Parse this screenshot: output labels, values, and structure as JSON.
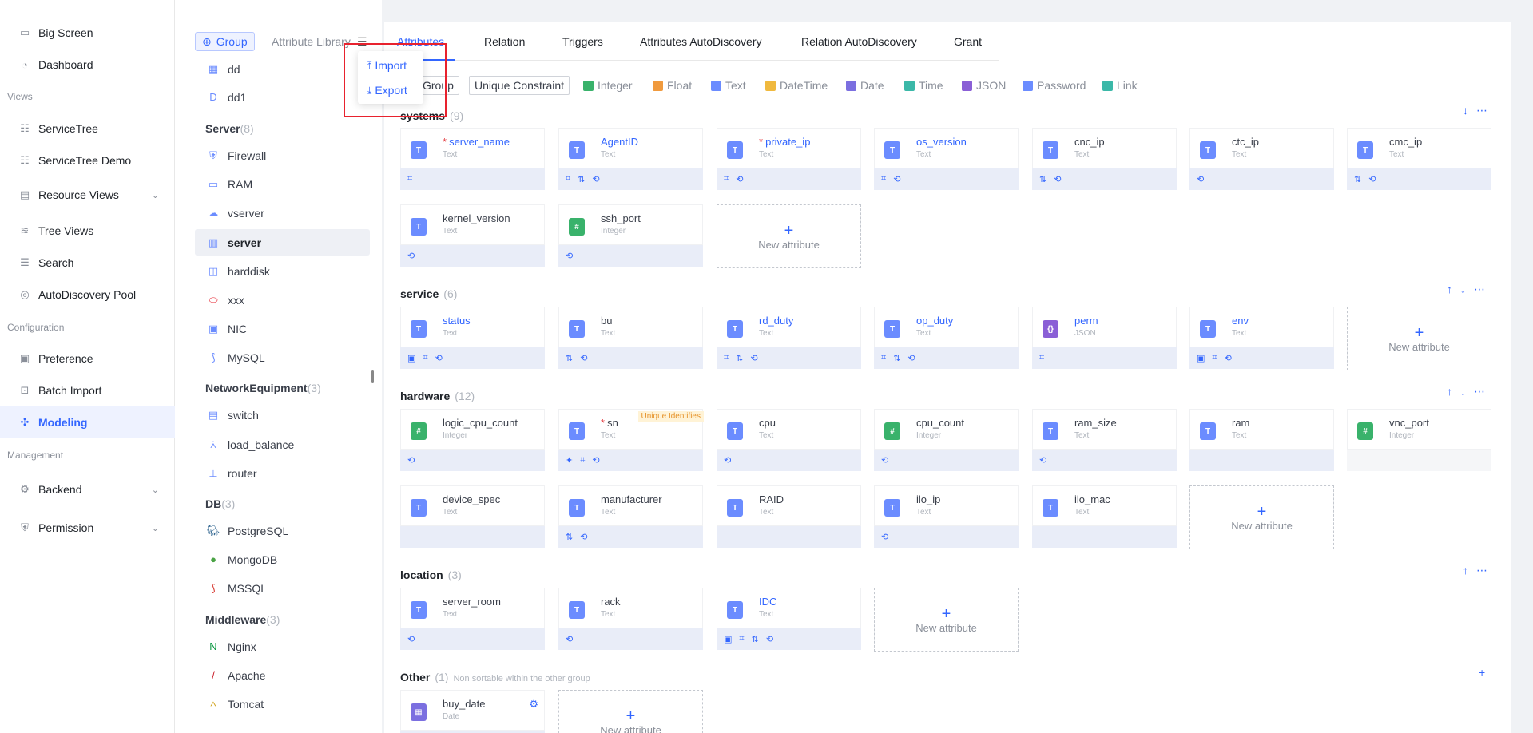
{
  "nav": {
    "items": [
      {
        "label": "Big Screen",
        "icon": "monitor-icon"
      },
      {
        "label": "Dashboard",
        "icon": "dashboard-icon"
      },
      {
        "label": "ServiceTree",
        "icon": "tree-list-icon"
      },
      {
        "label": "ServiceTree Demo",
        "icon": "tree-list-icon"
      },
      {
        "label": "Resource Views",
        "icon": "resource-icon"
      },
      {
        "label": "Tree Views",
        "icon": "layers-icon"
      },
      {
        "label": "Search",
        "icon": "search-list-icon"
      },
      {
        "label": "AutoDiscovery Pool",
        "icon": "discovery-icon"
      },
      {
        "label": "Preference",
        "icon": "bookmark-icon"
      },
      {
        "label": "Batch Import",
        "icon": "import-icon"
      },
      {
        "label": "Modeling",
        "icon": "modeling-icon"
      },
      {
        "label": "Backend",
        "icon": "gear-icon"
      },
      {
        "label": "Permission",
        "icon": "shield-icon"
      }
    ],
    "sections": {
      "views": "Views",
      "configuration": "Configuration",
      "management": "Management"
    }
  },
  "tree": {
    "group_button": "Group",
    "library_button": "Attribute Library",
    "top_items": [
      "dd",
      "dd1"
    ],
    "groups": [
      {
        "name": "Server",
        "count": "(8)",
        "items": [
          "Firewall",
          "RAM",
          "vserver",
          "server",
          "harddisk",
          "xxx",
          "NIC",
          "MySQL"
        ]
      },
      {
        "name": "NetworkEquipment",
        "count": "(3)",
        "items": [
          "switch",
          "load_balance",
          "router"
        ]
      },
      {
        "name": "DB",
        "count": "(3)",
        "items": [
          "PostgreSQL",
          "MongoDB",
          "MSSQL"
        ]
      },
      {
        "name": "Middleware",
        "count": "(3)",
        "items": [
          "Nginx",
          "Apache",
          "Tomcat"
        ]
      }
    ]
  },
  "tabs": [
    "Attributes",
    "Relation",
    "Triggers",
    "Attributes AutoDiscovery",
    "Relation AutoDiscovery",
    "Grant"
  ],
  "toolbar": {
    "group_chip": "Group",
    "unique_chip": "Unique Constraint",
    "types": [
      "Integer",
      "Float",
      "Text",
      "DateTime",
      "Date",
      "Time",
      "JSON",
      "Password",
      "Link"
    ]
  },
  "popup": {
    "import": "Import",
    "export": "Export"
  },
  "new_attribute": "New attribute",
  "sections": [
    {
      "title": "systems",
      "count": "(9)",
      "cards": [
        {
          "name": "server_name",
          "type": "Text",
          "required": true
        },
        {
          "name": "AgentID",
          "type": "Text"
        },
        {
          "name": "private_ip",
          "type": "Text",
          "required": true
        },
        {
          "name": "os_version",
          "type": "Text"
        },
        {
          "name": "cnc_ip",
          "type": "Text",
          "plain": true
        },
        {
          "name": "ctc_ip",
          "type": "Text",
          "plain": true
        },
        {
          "name": "cmc_ip",
          "type": "Text",
          "plain": true
        },
        {
          "name": "kernel_version",
          "type": "Text",
          "plain": true
        },
        {
          "name": "ssh_port",
          "type": "Integer",
          "plain": true
        }
      ]
    },
    {
      "title": "service",
      "count": "(6)",
      "cards": [
        {
          "name": "status",
          "type": "Text"
        },
        {
          "name": "bu",
          "type": "Text",
          "plain": true
        },
        {
          "name": "rd_duty",
          "type": "Text"
        },
        {
          "name": "op_duty",
          "type": "Text"
        },
        {
          "name": "perm",
          "type": "JSON"
        },
        {
          "name": "env",
          "type": "Text"
        }
      ]
    },
    {
      "title": "hardware",
      "count": "(12)",
      "cards": [
        {
          "name": "logic_cpu_count",
          "type": "Integer",
          "plain": true
        },
        {
          "name": "sn",
          "type": "Text",
          "required": true,
          "badge": "Unique Identifies"
        },
        {
          "name": "cpu",
          "type": "Text",
          "plain": true
        },
        {
          "name": "cpu_count",
          "type": "Integer",
          "plain": true
        },
        {
          "name": "ram_size",
          "type": "Text",
          "plain": true
        },
        {
          "name": "ram",
          "type": "Text",
          "plain": true
        },
        {
          "name": "vnc_port",
          "type": "Integer",
          "plain": true
        },
        {
          "name": "device_spec",
          "type": "Text",
          "plain": true
        },
        {
          "name": "manufacturer",
          "type": "Text",
          "plain": true
        },
        {
          "name": "RAID",
          "type": "Text",
          "plain": true
        },
        {
          "name": "ilo_ip",
          "type": "Text",
          "plain": true
        },
        {
          "name": "ilo_mac",
          "type": "Text",
          "plain": true
        }
      ]
    },
    {
      "title": "location",
      "count": "(3)",
      "cards": [
        {
          "name": "server_room",
          "type": "Text",
          "plain": true
        },
        {
          "name": "rack",
          "type": "Text",
          "plain": true
        },
        {
          "name": "IDC",
          "type": "Text"
        }
      ]
    },
    {
      "title": "Other",
      "count": "(1)",
      "note": "Non sortable within the other group",
      "cards": [
        {
          "name": "buy_date",
          "type": "Date",
          "plain": true
        }
      ]
    }
  ]
}
